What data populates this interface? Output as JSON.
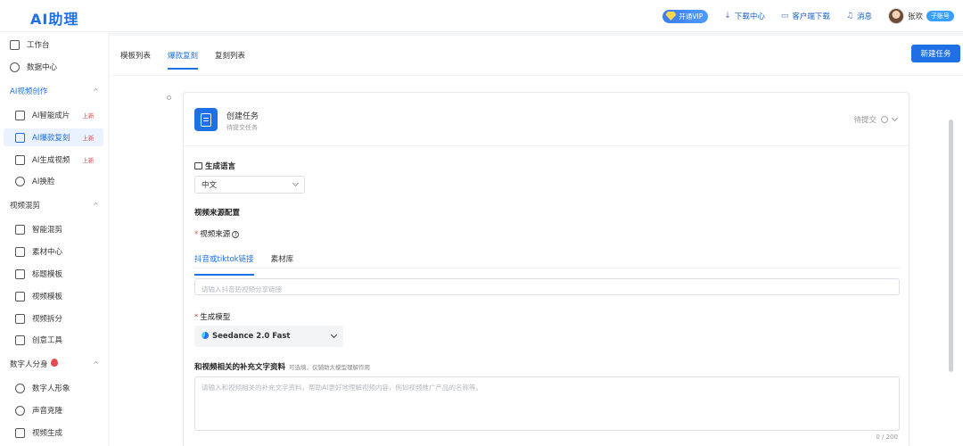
{
  "header": {
    "logo": "AI助理",
    "vip_label": "开通VIP",
    "download_center": "下载中心",
    "client_download": "客户端下载",
    "messages": "消息",
    "user_name": "张欢",
    "account_badge": "子账号"
  },
  "sidebar": {
    "workbench": "工作台",
    "data_center": "数据中心",
    "group_ai_video": "AI视频创作",
    "ai_smart": "AI智能成片",
    "ai_copy": "AI爆款复刻",
    "ai_generate": "AI生成视频",
    "ai_faceswap": "AI换脸",
    "new_tag": "上新",
    "group_mix": "视频混剪",
    "smart_mix": "智能混剪",
    "material": "素材中心",
    "title_tpl": "标题模板",
    "video_tpl": "视频模板",
    "video_split": "视频拆分",
    "creative": "创意工具",
    "group_digital": "数字人分身",
    "digital_avatar": "数字人形象",
    "voice_clone": "声音克隆",
    "video_gen": "视频生成"
  },
  "tabs": {
    "tpl_list": "模板列表",
    "hot_copy": "爆款复刻",
    "copy_list": "复刻列表"
  },
  "new_task_button": "新建任务",
  "task": {
    "title": "创建任务",
    "subtitle": "待提交任务",
    "status": "待提交"
  },
  "form": {
    "lang_label": "生成语言",
    "lang_value": "中文",
    "source_config": "视频来源配置",
    "source_label": "视频来源",
    "source_tab_link": "抖音或tiktok链接",
    "source_tab_lib": "素材库",
    "link_placeholder": "请输入抖音短视频分享链接",
    "model_label": "生成模型",
    "model_value": "Seedance 2.0 Fast",
    "supp_label": "和视频相关的补充文字资料",
    "supp_hint": "可选填，仅辅助大模型理解作用",
    "supp_placeholder": "请输入和视频相关的补充文字资料，帮助AI更好地理解视频内容，例如视频推广产品的名称等。",
    "counter": "0 / 200"
  }
}
